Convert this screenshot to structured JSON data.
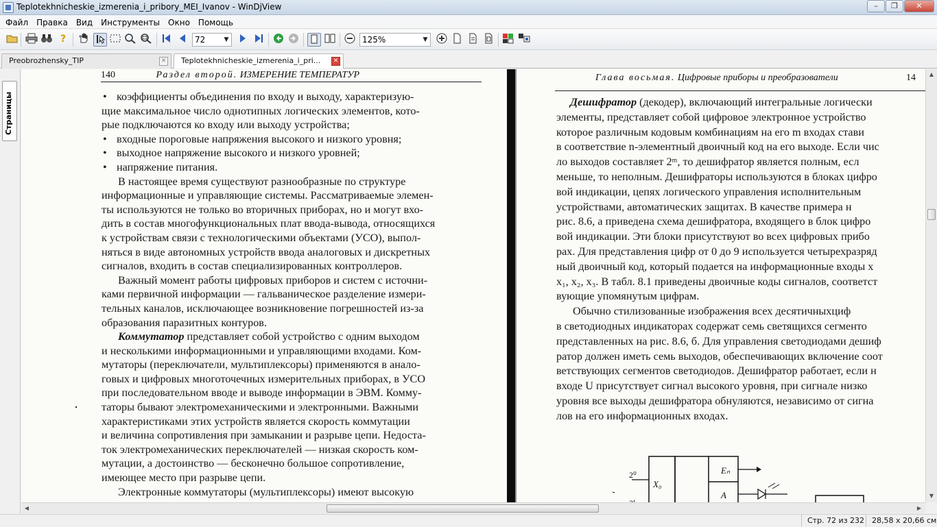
{
  "window": {
    "title": "Teplotekhnicheskie_izmerenia_i_pribory_MEI_Ivanov - WinDjView",
    "minimize": "–",
    "restore": "❐",
    "close": "✕"
  },
  "menu": [
    "Файл",
    "Правка",
    "Вид",
    "Инструменты",
    "Окно",
    "Помощь"
  ],
  "toolbar": {
    "page_value": "72",
    "zoom_value": "125%"
  },
  "tabs": [
    {
      "label": "Preobrozhensky_TIP",
      "active": false
    },
    {
      "label": "Teplotekhnicheskie_izmerenia_i_pri...",
      "active": true
    }
  ],
  "sidebar": {
    "pages_tab": "Страницы"
  },
  "left_page": {
    "page_number": "140",
    "running_head_spaced": "Раздел второй.",
    "running_head_title": "ИЗМЕРЕНИЕ ТЕМПЕРАТУР",
    "bullets": [
      [
        "коэффициенты объединения по входу и выходу, характеризую-",
        "щие максимальное число однотипных логических элементов, кото-",
        "рые подключаются ко входу или выходу устройства;"
      ],
      [
        "входные пороговые напряжения высокого и низкого уровня;"
      ],
      [
        "выходное напряжение высокого и низкого уровней;"
      ],
      [
        "напряжение питания."
      ]
    ],
    "para1": [
      "В настоящее время существуют разнообразные по структуре",
      "информационные и управляющие системы. Рассматриваемые элемен-",
      "ты используются не только во вторичных приборах, но и могут вхо-",
      "дить в состав многофункциональных плат ввода-вывода, относящихся",
      "к устройствам связи с технологическими объектами (УСО), выпол-",
      "няться в виде автономных устройств ввода аналоговых и дискретных",
      "сигналов, входить в состав специализированных контроллеров."
    ],
    "para2": [
      "Важный момент работы цифровых приборов и систем с источни-",
      "ками первичной информации — гальваническое разделение измери-",
      "тельных каналов, исключающее возникновение погрешностей из-за",
      "образования паразитных контуров."
    ],
    "para3_term": "Коммутатор",
    "para3": [
      " представляет собой устройство с одним выходом",
      "и несколькими информационными и управляющими входами. Ком-",
      "мутаторы (переключатели, мультиплексоры) применяются в анало-",
      "говых и цифровых многоточечных измерительных приборах, в УСО",
      "при последовательном вводе и выводе информации в ЭВМ. Комму-",
      "таторы бывают электромеханическими и электронными. Важными",
      "характеристиками этих устройств является скорость коммутации",
      "и величина сопротивления при замыкании и разрыве цепи. Недоста-",
      "ток электромеханических переключателей — низкая скорость ком-",
      "мутации, а достоинство — бесконечно большое сопротивление,",
      "имеющее место при разрыве цепи."
    ],
    "para4": [
      "Электронные коммутаторы (мультиплексоры) имеют высокую"
    ]
  },
  "right_page": {
    "page_number": "14",
    "running_head_spaced": "Глава восьмая.",
    "running_head_title": "Цифровые приборы и преобразователи",
    "para1_term": "Дешифратор",
    "para1": [
      " (декодер), включающий интегральные логически",
      "элементы, представляет собой цифровое электронное устройство",
      "которое различным кодовым комбинациям на его m входах стави",
      "в соответствие n-элементный двоичный код на его выходе. Если чис",
      "ло выходов составляет 2ᵐ, то дешифратор является полным, есл",
      "меньше, то неполным. Дешифраторы используются в блоках цифро",
      "вой индикации, цепях логического управления исполнительным",
      "устройствами, автоматических защитах. В качестве примера н",
      "рис. 8.6, а приведена схема дешифратора, входящего в блок цифро",
      "вой индикации. Эти блоки присутствуют во всех цифровых прибо",
      "рах. Для представления цифр от 0 до 9 используется четырехразряд",
      "ный двоичный код, который подается на информационные входы x",
      "x₁, x₂, x₃. В табл. 8.1 приведены двоичные коды сигналов, соответст",
      "вующие упомянутым цифрам."
    ],
    "para2": [
      "Обычно стилизованные изображения всех десятичныхциф",
      "в светодиодных индикаторах содержат семь светящихся сегменто",
      "представленных на рис. 8.6, б. Для управления светодиодами дешиф",
      "ратор должен иметь семь выходов, обеспечивающих включение соот",
      "ветствующих сегментов светодиодов. Дешифратор работает, если н",
      "входе U присутствует сигнал высокого уровня, при сигнале низко",
      "уровня все выходы дешифратора обнуляются, независимо от сигна",
      "лов на его информационных входах."
    ],
    "diagram": {
      "x0": "X₀",
      "en": "Eₙ",
      "a": "A",
      "p0": "2⁰",
      "p1": "2¹"
    }
  },
  "status": {
    "page": "Стр. 72 из 232",
    "size": "28,58 x 20,66 см"
  }
}
